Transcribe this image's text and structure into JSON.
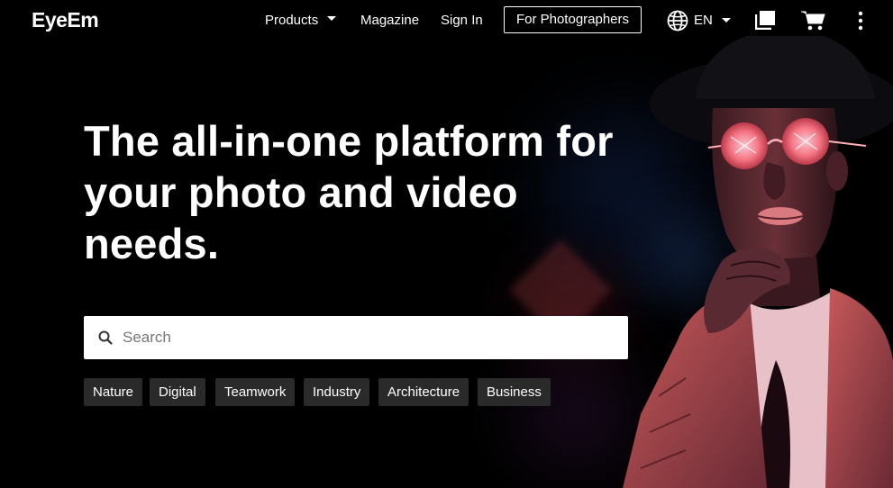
{
  "nav": {
    "logo": "EyeEm",
    "products": "Products",
    "magazine": "Magazine",
    "sign_in": "Sign In",
    "for_photographers": "For Photographers",
    "language": "EN"
  },
  "hero": {
    "headline": "The all-in-one platform for your photo and video needs.",
    "search_placeholder": "Search",
    "tags": [
      "Nature",
      "Digital",
      "Teamwork",
      "Industry",
      "Architecture",
      "Business"
    ]
  },
  "icons": {
    "globe": "globe-icon",
    "collections": "collections-icon",
    "cart": "cart-icon",
    "more": "more-vertical-icon",
    "search": "search-icon"
  },
  "colors": {
    "background": "#000000",
    "text": "#ffffff",
    "tag_background": "#2a2a2a",
    "search_background": "#ffffff",
    "accent_glow": "#ff5a6a"
  }
}
